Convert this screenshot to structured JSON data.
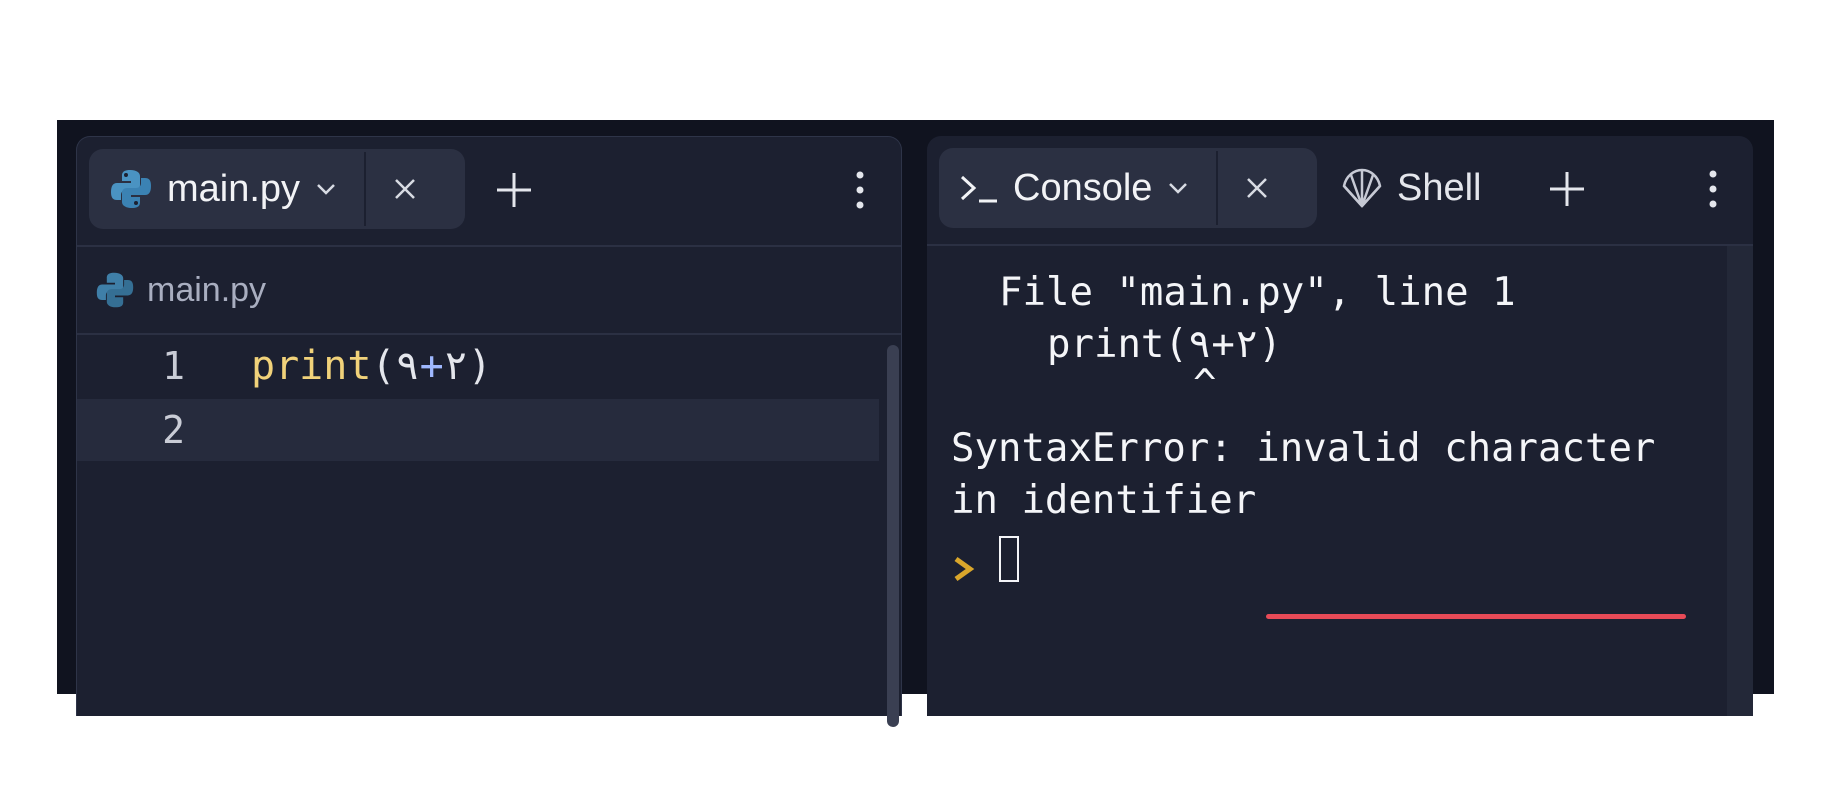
{
  "editor": {
    "tab": {
      "label": "main.py",
      "icon": "python-icon"
    },
    "breadcrumb": {
      "label": "main.py"
    },
    "lines": [
      {
        "number": "1",
        "fn": "print",
        "open": "(",
        "a": "٢",
        "op": "+",
        "b": "٩",
        "close": ")"
      },
      {
        "number": "2"
      }
    ]
  },
  "console": {
    "tab": {
      "label": "Console",
      "icon": "terminal-icon"
    },
    "shell_tab": {
      "label": "Shell",
      "icon": "shell-icon"
    },
    "output": {
      "file_line": "File \"main.py\", line 1",
      "code_line": "print(٢+٩)",
      "caret": "^",
      "error_prefix": "SyntaxError: ",
      "error_highlight": "invalid character",
      "error_rest": "in identifier"
    }
  },
  "colors": {
    "accent_underline": "#e84a57",
    "keyword": "#f1d27a",
    "prompt": "#d9a62b"
  }
}
